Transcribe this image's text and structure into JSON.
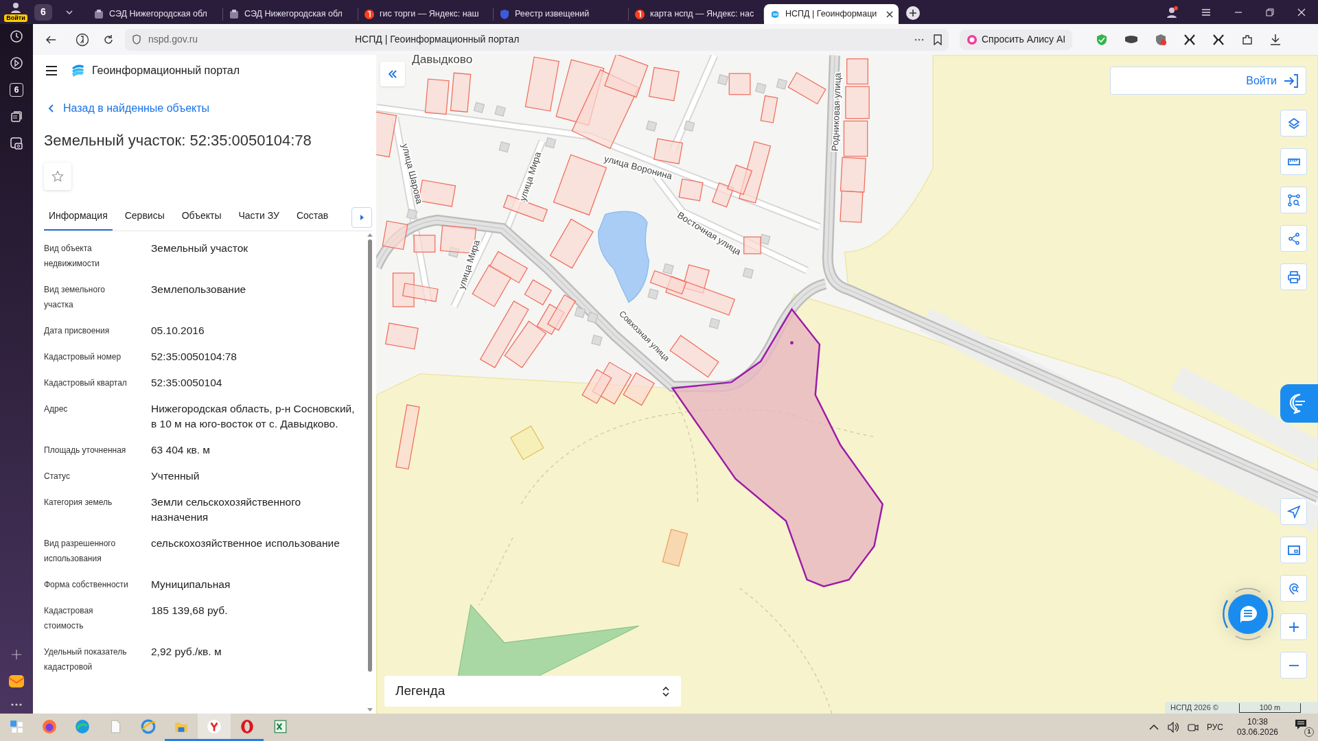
{
  "browser": {
    "profile_label": "Войти",
    "tab_count": "6",
    "tabs": [
      {
        "title": "СЭД Нижегородская обл",
        "kind": "sed",
        "selected": false
      },
      {
        "title": "СЭД Нижегородская обл",
        "kind": "sed",
        "selected": false
      },
      {
        "title": "гис торги — Яндекс: наш",
        "kind": "yandex",
        "selected": false
      },
      {
        "title": "Реестр извещений",
        "kind": "shield",
        "selected": false
      },
      {
        "title": "карта нспд — Яндекс: нас",
        "kind": "yandex",
        "selected": false
      },
      {
        "title": "НСПД | Геоинформаци",
        "kind": "nspd",
        "selected": true
      }
    ],
    "url": "nspd.gov.ru",
    "page_title": "НСПД | Геоинформационный портал",
    "alice_button": "Спросить Алису AI",
    "sidebar_badge": "6"
  },
  "portal": {
    "title": "Геоинформационный портал",
    "back_link": "Назад в найденные объекты",
    "heading": "Земельный участок: 52:35:0050104:78",
    "tabs": [
      {
        "label": "Информация",
        "selected": true
      },
      {
        "label": "Сервисы",
        "selected": false
      },
      {
        "label": "Объекты",
        "selected": false
      },
      {
        "label": "Части ЗУ",
        "selected": false
      },
      {
        "label": "Состав",
        "selected": false
      }
    ],
    "fields": [
      {
        "label": "Вид объекта недвижимости",
        "value": "Земельный участок"
      },
      {
        "label": "Вид земельного участка",
        "value": "Землепользование"
      },
      {
        "label": "Дата присвоения",
        "value": "05.10.2016"
      },
      {
        "label": "Кадастровый номер",
        "value": "52:35:0050104:78"
      },
      {
        "label": "Кадастровый квартал",
        "value": "52:35:0050104"
      },
      {
        "label": "Адрес",
        "value": "Нижегородская область, р-н Сосновский, в 10 м на юго-восток от с. Давыдково."
      },
      {
        "label": "Площадь уточненная",
        "value": "63 404 кв. м"
      },
      {
        "label": "Статус",
        "value": "Учтенный"
      },
      {
        "label": "Категория земель",
        "value": "Земли сельскохозяйственного назначения"
      },
      {
        "label": "Вид разрешенного использования",
        "value": "сельскохозяйственное использование"
      },
      {
        "label": "Форма собственности",
        "value": "Муниципальная"
      },
      {
        "label": "Кадастровая стоимость",
        "value": "185 139,68 руб."
      },
      {
        "label": "Удельный показатель кадастровой",
        "value": "2,92 руб./кв. м"
      }
    ]
  },
  "map": {
    "place_labels": [
      "Давыдково",
      "улица Шарова",
      "улица Мира",
      "улица Воронина",
      "Восточная улица",
      "улица Мира",
      "Совхозная улица",
      "Родниковая улица"
    ],
    "login_button": "Войти",
    "legend": "Легенда",
    "attribution": "НСПД 2026 ©",
    "scale": "100 m"
  },
  "taskbar": {
    "language": "РУС",
    "time": "10:38",
    "date": "03.06.2026",
    "notifications": "1"
  }
}
